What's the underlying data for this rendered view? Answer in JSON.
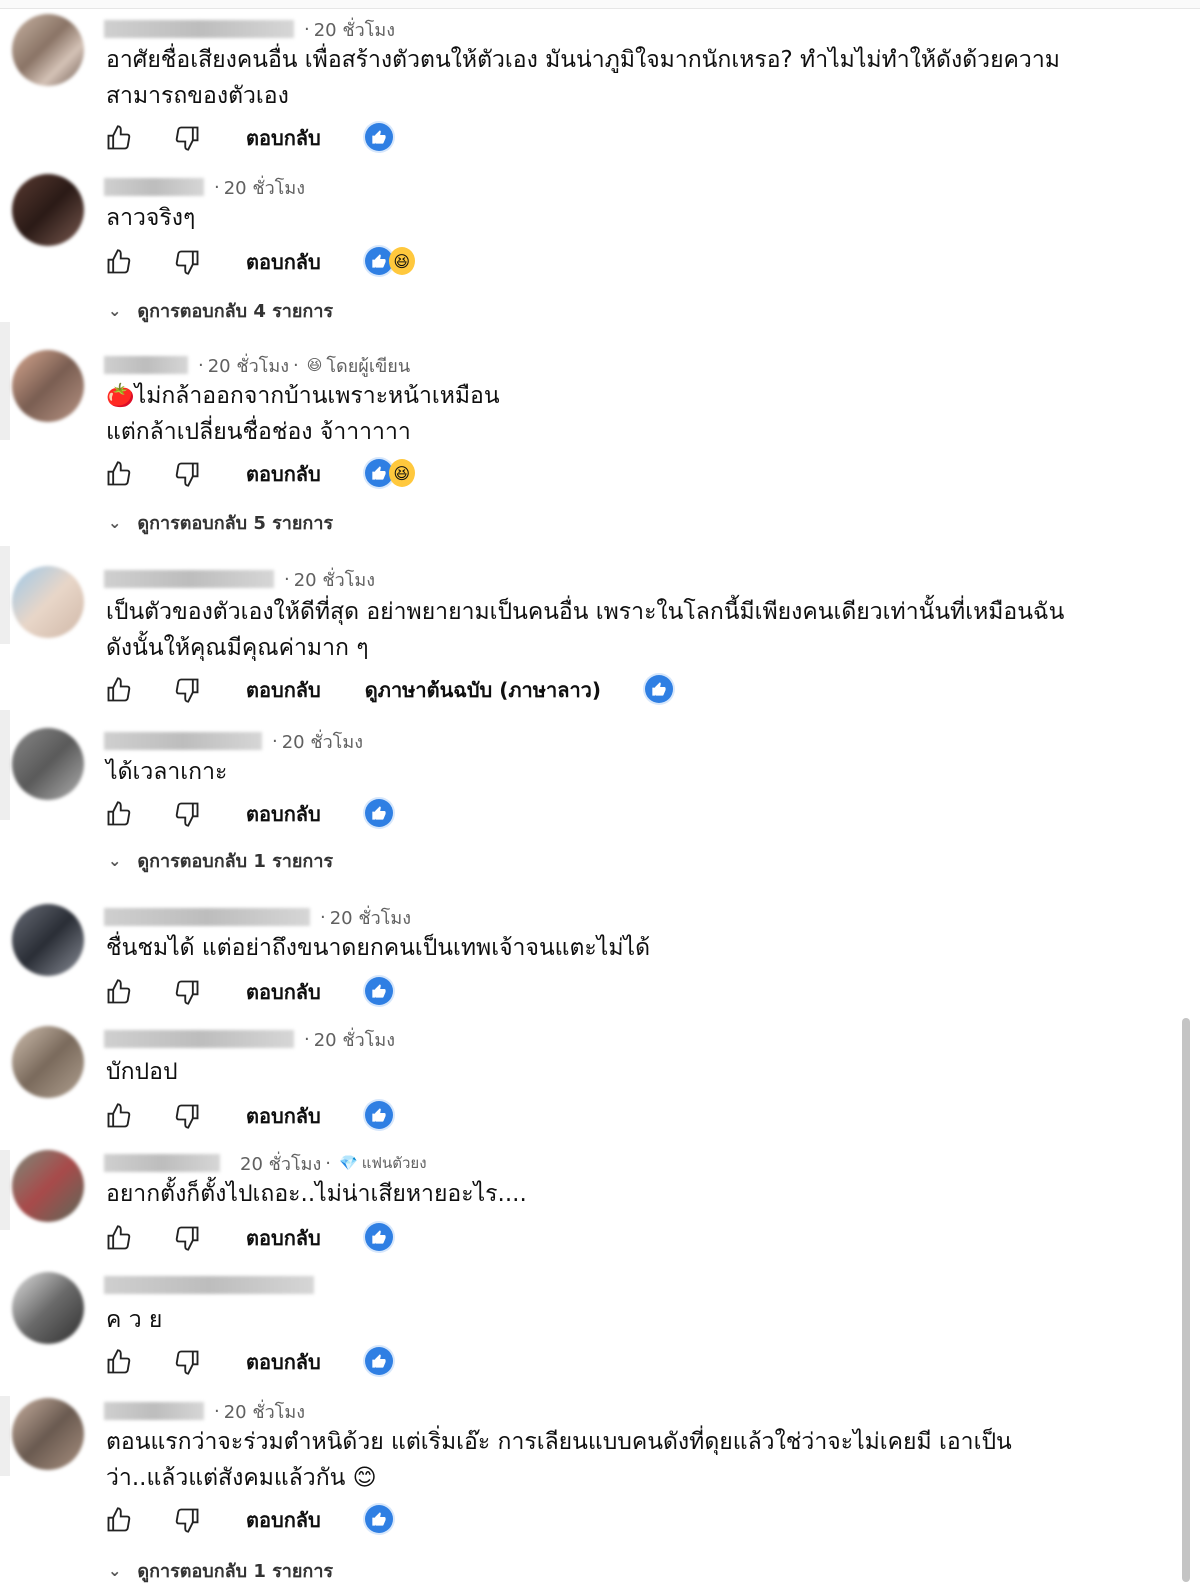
{
  "reply_label": "ตอบกลับ",
  "comments": [
    {
      "meta": "20 ชั่วโมง",
      "text": "อาศัยชื่อเสียงคนอื่น เพื่อสร้างตัวตนให้ตัวเอง มันน่าภูมิใจมากนักเหรอ? ทำไมไม่ทำให้ดังด้วยความ\nสามารถของตัวเอง"
    },
    {
      "meta": "20 ชั่วโมง",
      "text": "ลาวจริงๆ",
      "more": "ดูการตอบกลับ 4 รายการ"
    },
    {
      "meta": "20 ชั่วโมง",
      "author_badge": "โดยผู้เขียน",
      "text": "ไม่กล้าออกจากบ้านเพราะหน้าเหมือน\nแต่กล้าเปลี่ยนชื่อช่อง จ้าาาาาา",
      "more": "ดูการตอบกลับ 5 รายการ"
    },
    {
      "meta": "20 ชั่วโมง",
      "text": "เป็นตัวของตัวเองให้ดีที่สุด อย่าพยายามเป็นคนอื่น เพราะในโลกนี้มีเพียงคนเดียวเท่านั้นที่เหมือนฉัน\nดังนั้นให้คุณมีคุณค่ามาก ๆ",
      "translate": "ดูภาษาต้นฉบับ (ภาษาลาว)"
    },
    {
      "meta": "20 ชั่วโมง",
      "text": "ได้เวลาเกาะ",
      "more": "ดูการตอบกลับ 1 รายการ"
    },
    {
      "meta": "20 ชั่วโมง",
      "text": "ชื่นชมได้ แต่อย่าถึงขนาดยกคนเป็นเทพเจ้าจนแตะไม่ได้"
    },
    {
      "meta": "20 ชั่วโมง",
      "text": "บักปอป"
    },
    {
      "meta": "20 ชั่วโมง",
      "member_badge": "แฟนตัวยง",
      "text": "อยากตั้งก็ตั้งไปเถอะ..ไม่น่าเสียหายอะไร...."
    },
    {
      "meta": "",
      "text": "ค ว ย"
    },
    {
      "meta": "20 ชั่วโมง",
      "text": "ตอนแรกว่าจะร่วมตำหนิด้วย แต่เริ่มเอ๊ะ การเลียนแบบคนดังที่ดุยแล้วใช่ว่าจะไม่เคยมี เอาเป็น\nว่า..แล้วแต่สังคมแล้วกัน 😊",
      "more": "ดูการตอบกลับ 1 รายการ"
    }
  ]
}
